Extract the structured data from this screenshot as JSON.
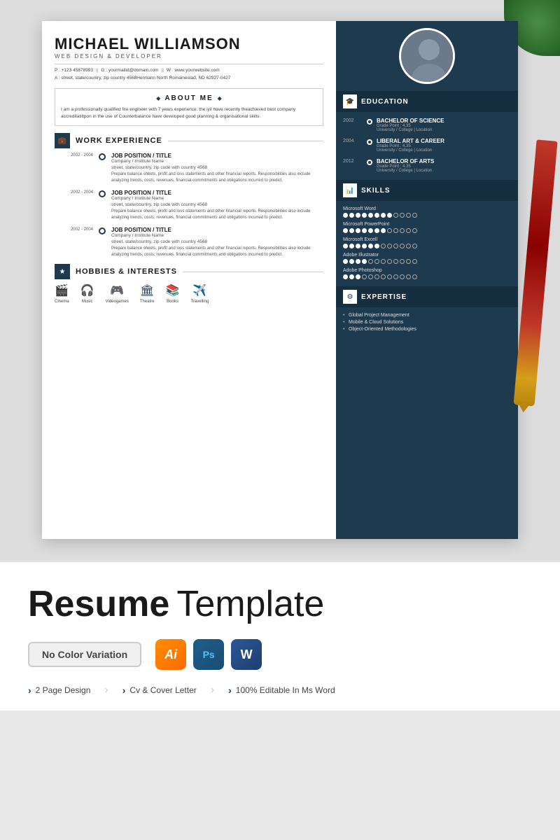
{
  "resume": {
    "name": "MICHAEL WILLIAMSON",
    "title": "WEB DESIGN & DEVELOPER",
    "contact": {
      "phone": "P : +123 45678993",
      "email": "G : yourmailid@domain.com",
      "website": "W : www.yourwebsite.com",
      "address": "A : street, state/country, zip country 4568Hermann North Romainestad, ND 62927-0427"
    },
    "about": "I am a professionally qualified fire engineer with 7 years experience. the iyil have recently theachieved best company accreditatiltpon in the use of Counterbalance have developed good planning & organisational skills.",
    "work_experience": {
      "section_title": "WORK EXPERIENCE",
      "entries": [
        {
          "date": "2002 - 2004",
          "title": "JOB POSITION / TITLE",
          "company": "Company / Institute Name",
          "address": "street, state/country, zip code with country 4568",
          "description": "Prepare balance sheets, profit and loss statements and other financial reports. Responsibilities also include analyzing trends, costs, revenues, financial commitments and obligations incurred to predict."
        },
        {
          "date": "2002 - 2004",
          "title": "JOB POSITION / TITLE",
          "company": "Company / Institute Name",
          "address": "street, state/country, zip code with country 4568",
          "description": "Prepare balance sheets, profit and loss statements and other financial reports. Responsibilities also include analyzing trends, costs, revenues, financial commitments and obligations incurred to predict."
        },
        {
          "date": "2002 - 2004",
          "title": "JOB POSITION / TITLE",
          "company": "Company / Institute Name",
          "address": "street, state/country, zip code with country 4568",
          "description": "Prepare balance sheets, profit and loss statements and other financial reports. Responsibilities also include analyzing trends, costs, revenues, financial commitments and obligations incurred to predict."
        }
      ]
    },
    "hobbies": {
      "section_title": "HOBBIES & INTERESTS",
      "items": [
        {
          "label": "Cinema",
          "icon": "🎬"
        },
        {
          "label": "Music",
          "icon": "🎧"
        },
        {
          "label": "Videogames",
          "icon": "🎮"
        },
        {
          "label": "Theatre",
          "icon": "🏛"
        },
        {
          "label": "Books",
          "icon": "📚"
        },
        {
          "label": "Travelling",
          "icon": "✈️"
        }
      ]
    },
    "education": {
      "section_title": "EDUCATION",
      "entries": [
        {
          "year": "2002",
          "degree": "BACHELOR OF SCIENCE",
          "grade": "Grade Point : 4.35",
          "location": "University / College  |  Location"
        },
        {
          "year": "2004",
          "degree": "LIBERAL ART & CAREER",
          "grade": "Grade Point : 4.35",
          "location": "University / College  |  Location"
        },
        {
          "year": "2012",
          "degree": "BACHELOR OF ARTS",
          "grade": "Grade Point : 4.35",
          "location": "University / College  |  Location"
        }
      ]
    },
    "skills": {
      "section_title": "SKILLS",
      "items": [
        {
          "name": "Microsoft Word",
          "filled": 8,
          "total": 12
        },
        {
          "name": "Microsoft PowerPoint",
          "filled": 7,
          "total": 12
        },
        {
          "name": "Microsoft Excell",
          "filled": 6,
          "total": 12
        },
        {
          "name": "Adobe Illustrator",
          "filled": 4,
          "total": 12
        },
        {
          "name": "Adobe Photoshop",
          "filled": 3,
          "total": 12
        }
      ]
    },
    "expertise": {
      "section_title": "EXPERTISE",
      "items": [
        "Global Project Management",
        "Mobile & Cloud Solutions",
        "Object-Oriented Methodologies"
      ]
    }
  },
  "bottom": {
    "heading_bold": "Resume",
    "heading_light": "Template",
    "no_color_label": "No Color Variation",
    "software_icons": [
      {
        "label": "Ai",
        "type": "ai"
      },
      {
        "label": "Ps",
        "type": "ps"
      },
      {
        "label": "W",
        "type": "word"
      }
    ],
    "features": [
      "2 Page Design",
      "Cv & Cover Letter",
      "100% Editable In Ms Word"
    ]
  }
}
